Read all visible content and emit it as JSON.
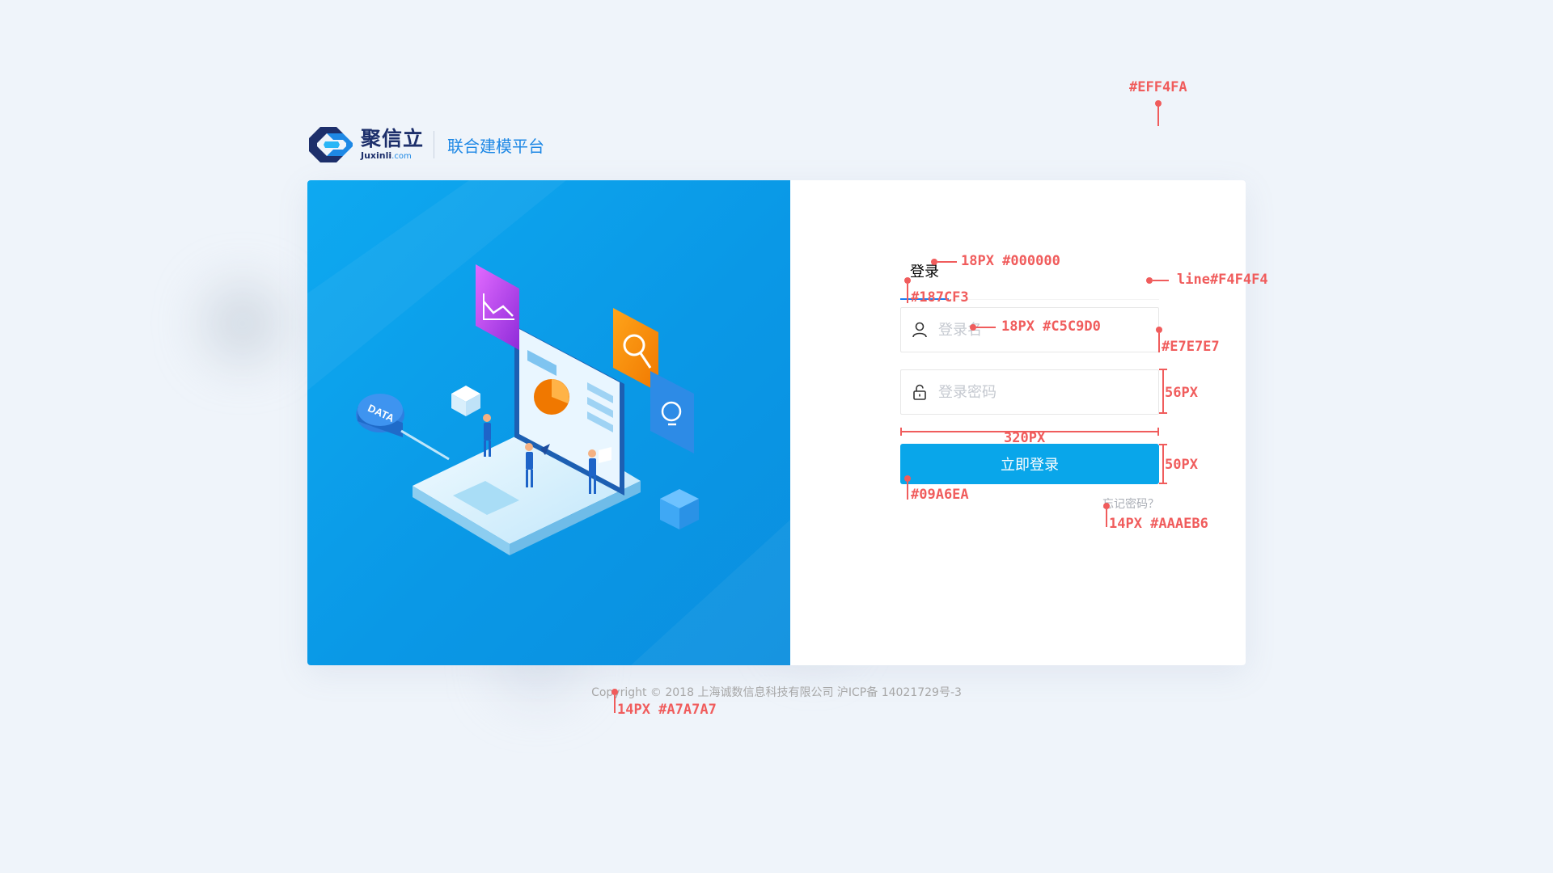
{
  "brand": {
    "name_cn": "聚信立",
    "name_en": "Juxinli",
    "domain_suffix": ".com",
    "platform": "联合建模平台"
  },
  "illustration": {
    "data_tag": "DATA"
  },
  "login": {
    "tab_label": "登录",
    "username_placeholder": "登录名",
    "password_placeholder": "登录密码",
    "submit_label": "立即登录",
    "forgot_label": "忘记密码？"
  },
  "footer": {
    "copyright": "Copyright © 2018 上海诚数信息科技有限公司 沪ICP备 14021729号-3"
  },
  "annotations": {
    "bg_color": "#EFF4FA",
    "tab_font": "18PX #000000",
    "tab_line": "line#F4F4F4",
    "tab_underline": "#187CF3",
    "input_font": "18PX #C5C9D0",
    "input_border": "#E7E7E7",
    "input_height": "56PX",
    "form_width": "320PX",
    "button_height": "50PX",
    "button_color": "#09A6EA",
    "forgot_font": "14PX #AAAEB6",
    "footer_font": "14PX #A7A7A7"
  },
  "colors": {
    "page_bg": "#EFF4FA",
    "primary": "#09A6EA",
    "tab_active": "#187CF3",
    "annotation": "#F05C5C"
  },
  "icons": [
    "logo-icon",
    "user-icon",
    "lock-icon"
  ]
}
